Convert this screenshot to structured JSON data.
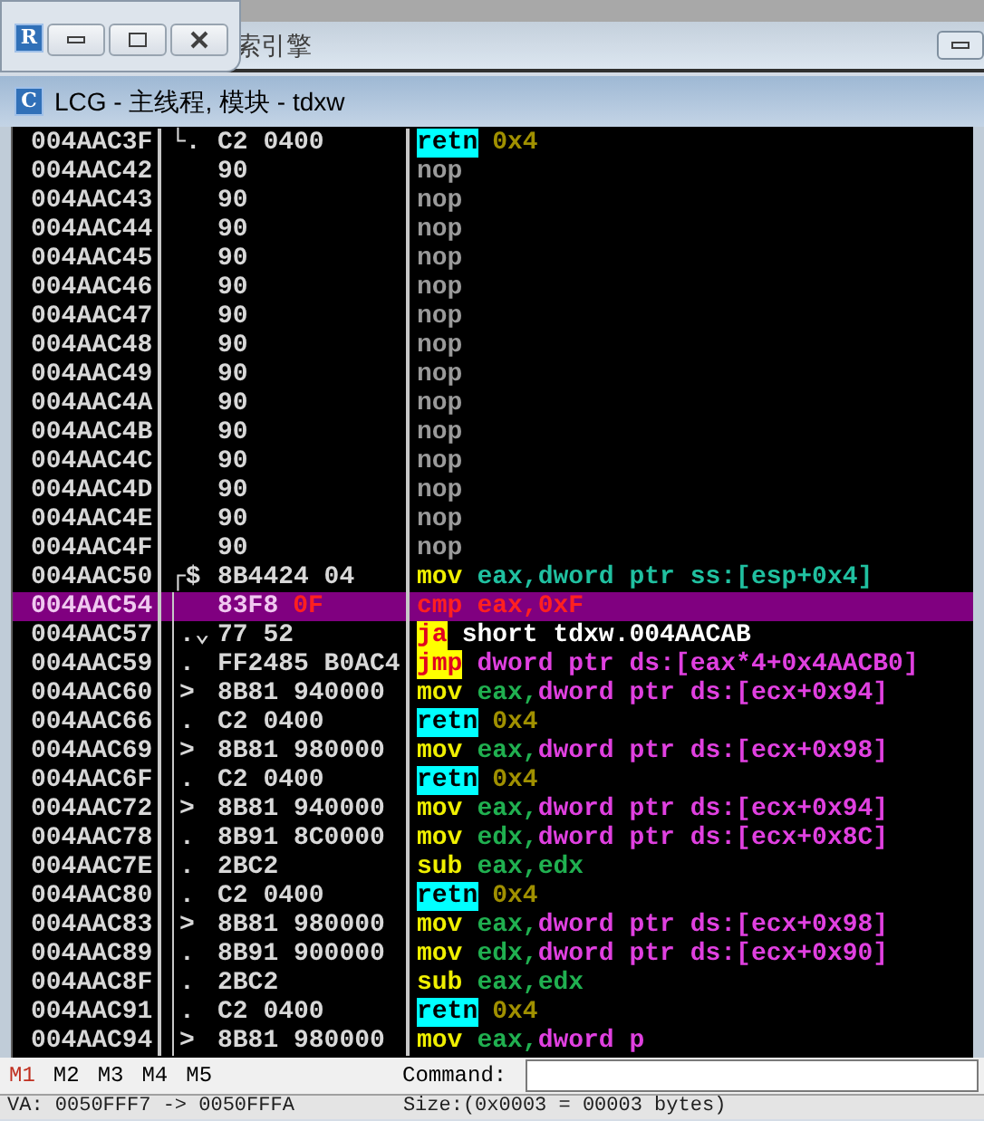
{
  "floating_window": {
    "icon_letter": "R"
  },
  "background_window": {
    "title": "索引擎"
  },
  "window": {
    "icon_letter": "C",
    "title": "LCG - 主线程, 模块 - tdxw"
  },
  "rows": [
    {
      "address": "004AAC3F",
      "mark": "└.",
      "hex": "C2 0400",
      "instruction": [
        {
          "text": "retn",
          "kind": "return"
        },
        {
          "text": "0x4",
          "kind": "imm"
        }
      ],
      "selected": false,
      "bracket": false
    },
    {
      "address": "004AAC42",
      "mark": "",
      "hex": "90",
      "instruction": [
        {
          "text": "nop",
          "kind": "nop"
        }
      ],
      "selected": false,
      "bracket": false
    },
    {
      "address": "004AAC43",
      "mark": "",
      "hex": "90",
      "instruction": [
        {
          "text": "nop",
          "kind": "nop"
        }
      ],
      "selected": false,
      "bracket": false
    },
    {
      "address": "004AAC44",
      "mark": "",
      "hex": "90",
      "instruction": [
        {
          "text": "nop",
          "kind": "nop"
        }
      ],
      "selected": false,
      "bracket": false
    },
    {
      "address": "004AAC45",
      "mark": "",
      "hex": "90",
      "instruction": [
        {
          "text": "nop",
          "kind": "nop"
        }
      ],
      "selected": false,
      "bracket": false
    },
    {
      "address": "004AAC46",
      "mark": "",
      "hex": "90",
      "instruction": [
        {
          "text": "nop",
          "kind": "nop"
        }
      ],
      "selected": false,
      "bracket": false
    },
    {
      "address": "004AAC47",
      "mark": "",
      "hex": "90",
      "instruction": [
        {
          "text": "nop",
          "kind": "nop"
        }
      ],
      "selected": false,
      "bracket": false
    },
    {
      "address": "004AAC48",
      "mark": "",
      "hex": "90",
      "instruction": [
        {
          "text": "nop",
          "kind": "nop"
        }
      ],
      "selected": false,
      "bracket": false
    },
    {
      "address": "004AAC49",
      "mark": "",
      "hex": "90",
      "instruction": [
        {
          "text": "nop",
          "kind": "nop"
        }
      ],
      "selected": false,
      "bracket": false
    },
    {
      "address": "004AAC4A",
      "mark": "",
      "hex": "90",
      "instruction": [
        {
          "text": "nop",
          "kind": "nop"
        }
      ],
      "selected": false,
      "bracket": false
    },
    {
      "address": "004AAC4B",
      "mark": "",
      "hex": "90",
      "instruction": [
        {
          "text": "nop",
          "kind": "nop"
        }
      ],
      "selected": false,
      "bracket": false
    },
    {
      "address": "004AAC4C",
      "mark": "",
      "hex": "90",
      "instruction": [
        {
          "text": "nop",
          "kind": "nop"
        }
      ],
      "selected": false,
      "bracket": false
    },
    {
      "address": "004AAC4D",
      "mark": "",
      "hex": "90",
      "instruction": [
        {
          "text": "nop",
          "kind": "nop"
        }
      ],
      "selected": false,
      "bracket": false
    },
    {
      "address": "004AAC4E",
      "mark": "",
      "hex": "90",
      "instruction": [
        {
          "text": "nop",
          "kind": "nop"
        }
      ],
      "selected": false,
      "bracket": false
    },
    {
      "address": "004AAC4F",
      "mark": "",
      "hex": "90",
      "instruction": [
        {
          "text": "nop",
          "kind": "nop"
        }
      ],
      "selected": false,
      "bracket": false
    },
    {
      "address": "004AAC50",
      "mark": "┌$",
      "hex": "8B4424 04",
      "instruction": [
        {
          "text": "mov",
          "kind": "move"
        },
        {
          "text": "eax,dword ptr ss:[esp+0x4]",
          "kind": "stack"
        }
      ],
      "selected": false,
      "bracket": false
    },
    {
      "address": "004AAC54",
      "mark": "",
      "hex": "83F8",
      "hex_tail": "0F",
      "instruction": [
        {
          "text": "cmp",
          "kind": "move"
        },
        {
          "text": "eax,0xF",
          "kind": "reg"
        }
      ],
      "selected": true,
      "bracket": true
    },
    {
      "address": "004AAC57",
      "mark": ".⌄",
      "hex": "77 52",
      "instruction": [
        {
          "text": "ja",
          "kind": "jump"
        },
        {
          "text": "short tdxw.004AACAB",
          "kind": "plain"
        }
      ],
      "selected": false,
      "bracket": true
    },
    {
      "address": "004AAC59",
      "mark": ".",
      "hex": "FF2485 B0AC4",
      "instruction": [
        {
          "text": "jmp",
          "kind": "jump"
        },
        {
          "text": "dword ptr ds:[eax*4+0x4AACB0]",
          "kind": "mem"
        }
      ],
      "selected": false,
      "bracket": true
    },
    {
      "address": "004AAC60",
      "mark": ">",
      "hex": "8B81 940000",
      "instruction": [
        {
          "text": "mov",
          "kind": "move"
        },
        {
          "text": "eax,",
          "kind": "reg"
        },
        {
          "text": "dword ptr ds:[ecx+0x94]",
          "kind": "mem"
        }
      ],
      "selected": false,
      "bracket": true
    },
    {
      "address": "004AAC66",
      "mark": ".",
      "hex": "C2 0400",
      "instruction": [
        {
          "text": "retn",
          "kind": "return"
        },
        {
          "text": "0x4",
          "kind": "imm"
        }
      ],
      "selected": false,
      "bracket": true
    },
    {
      "address": "004AAC69",
      "mark": ">",
      "hex": "8B81 980000",
      "instruction": [
        {
          "text": "mov",
          "kind": "move"
        },
        {
          "text": "eax,",
          "kind": "reg"
        },
        {
          "text": "dword ptr ds:[ecx+0x98]",
          "kind": "mem"
        }
      ],
      "selected": false,
      "bracket": true
    },
    {
      "address": "004AAC6F",
      "mark": ".",
      "hex": "C2 0400",
      "instruction": [
        {
          "text": "retn",
          "kind": "return"
        },
        {
          "text": "0x4",
          "kind": "imm"
        }
      ],
      "selected": false,
      "bracket": true
    },
    {
      "address": "004AAC72",
      "mark": ">",
      "hex": "8B81 940000",
      "instruction": [
        {
          "text": "mov",
          "kind": "move"
        },
        {
          "text": "eax,",
          "kind": "reg"
        },
        {
          "text": "dword ptr ds:[ecx+0x94]",
          "kind": "mem"
        }
      ],
      "selected": false,
      "bracket": true
    },
    {
      "address": "004AAC78",
      "mark": ".",
      "hex": "8B91 8C0000",
      "instruction": [
        {
          "text": "mov",
          "kind": "move"
        },
        {
          "text": "edx,",
          "kind": "reg"
        },
        {
          "text": "dword ptr ds:[ecx+0x8C]",
          "kind": "mem"
        }
      ],
      "selected": false,
      "bracket": true
    },
    {
      "address": "004AAC7E",
      "mark": ".",
      "hex": "2BC2",
      "instruction": [
        {
          "text": "sub",
          "kind": "move"
        },
        {
          "text": "eax,edx",
          "kind": "reg"
        }
      ],
      "selected": false,
      "bracket": true
    },
    {
      "address": "004AAC80",
      "mark": ".",
      "hex": "C2 0400",
      "instruction": [
        {
          "text": "retn",
          "kind": "return"
        },
        {
          "text": "0x4",
          "kind": "imm"
        }
      ],
      "selected": false,
      "bracket": true
    },
    {
      "address": "004AAC83",
      "mark": ">",
      "hex": "8B81 980000",
      "instruction": [
        {
          "text": "mov",
          "kind": "move"
        },
        {
          "text": "eax,",
          "kind": "reg"
        },
        {
          "text": "dword ptr ds:[ecx+0x98]",
          "kind": "mem"
        }
      ],
      "selected": false,
      "bracket": true
    },
    {
      "address": "004AAC89",
      "mark": ".",
      "hex": "8B91 900000",
      "instruction": [
        {
          "text": "mov",
          "kind": "move"
        },
        {
          "text": "edx,",
          "kind": "reg"
        },
        {
          "text": "dword ptr ds:[ecx+0x90]",
          "kind": "mem"
        }
      ],
      "selected": false,
      "bracket": true
    },
    {
      "address": "004AAC8F",
      "mark": ".",
      "hex": "2BC2",
      "instruction": [
        {
          "text": "sub",
          "kind": "move"
        },
        {
          "text": "eax,edx",
          "kind": "reg"
        }
      ],
      "selected": false,
      "bracket": true
    },
    {
      "address": "004AAC91",
      "mark": ".",
      "hex": "C2 0400",
      "instruction": [
        {
          "text": "retn",
          "kind": "return"
        },
        {
          "text": "0x4",
          "kind": "imm"
        }
      ],
      "selected": false,
      "bracket": true
    },
    {
      "address": "004AAC94",
      "mark": ">",
      "hex": "8B81 980000",
      "instruction": [
        {
          "text": "mov",
          "kind": "move"
        },
        {
          "text": "eax,",
          "kind": "reg"
        },
        {
          "text": "dword p",
          "kind": "mem"
        }
      ],
      "selected": false,
      "bracket": true
    }
  ],
  "marker_tabs": [
    {
      "label": "M1",
      "selected": true
    },
    {
      "label": "M2",
      "selected": false
    },
    {
      "label": "M3",
      "selected": false
    },
    {
      "label": "M4",
      "selected": false
    },
    {
      "label": "M5",
      "selected": false
    }
  ],
  "command": {
    "label": "Command:"
  },
  "status_bar": {
    "address_range": "VA: 0050FFF7 -> 0050FFFA",
    "size": "Size:(0x0003 = 00003 bytes)"
  }
}
